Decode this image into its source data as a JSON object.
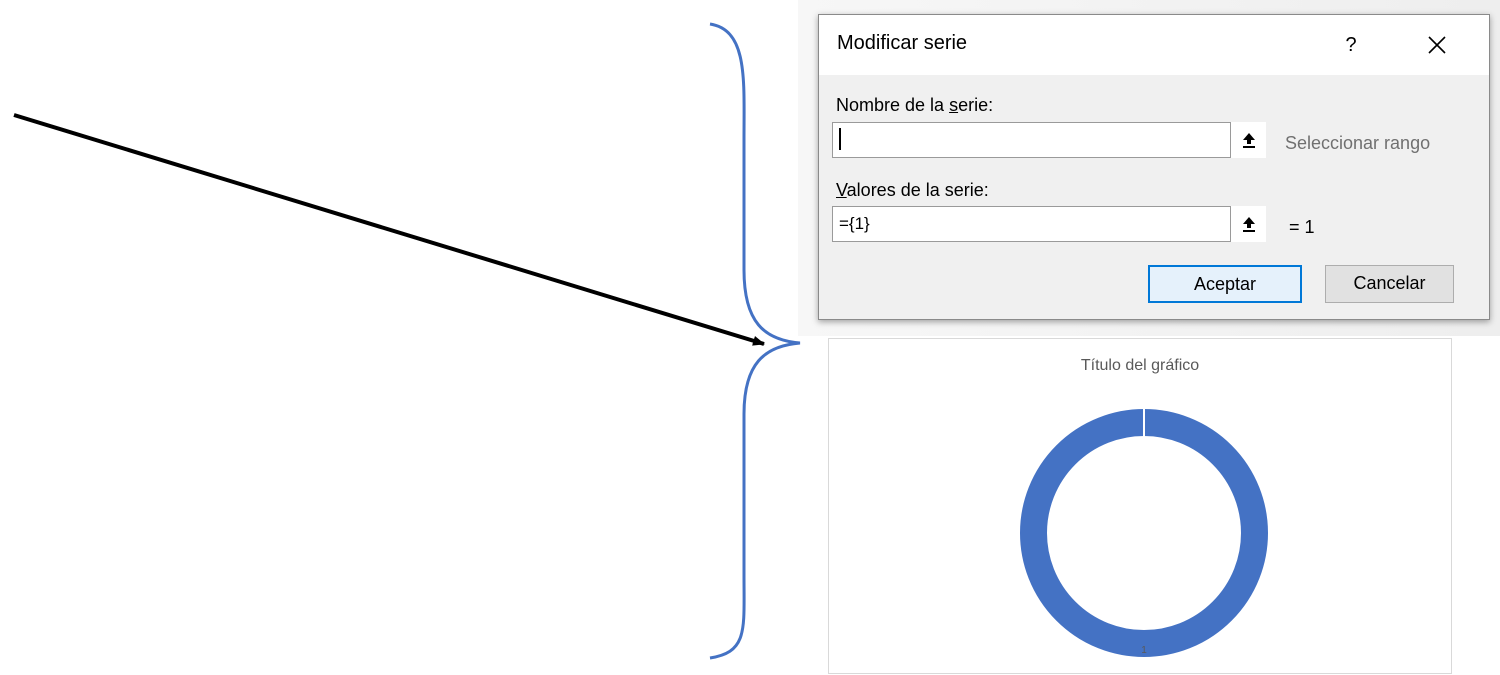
{
  "dialog": {
    "title": "Modificar serie",
    "help_label": "?",
    "name_label": {
      "pre": "Nombre de la ",
      "accel": "s",
      "post": "erie:"
    },
    "name_value": "",
    "select_range_hint": "Seleccionar rango",
    "values_label": {
      "pre": "",
      "accel": "V",
      "post": "alores de la serie:"
    },
    "values_value": "={1}",
    "values_preview": "= 1",
    "ok_label": "Aceptar",
    "cancel_label": "Cancelar",
    "icons": {
      "help": "help-icon",
      "close": "close-icon",
      "collapse": "collapse-range-icon"
    }
  },
  "chart": {
    "legend_label": "1"
  },
  "chart_data": {
    "type": "pie",
    "title": "Título del gráfico",
    "categories": [
      "1"
    ],
    "values": [
      1
    ],
    "donut": true,
    "colors": [
      "#4472c4"
    ],
    "legend": "bottom"
  },
  "annotation": {
    "arrow_color": "#000000",
    "brace_color": "#4472c4"
  }
}
